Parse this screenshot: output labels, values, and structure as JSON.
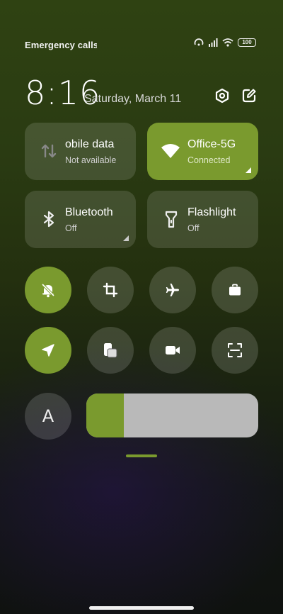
{
  "status_bar": {
    "carrier_text": "Emergency calls o",
    "battery_level": "100"
  },
  "header": {
    "time": "8:16",
    "date": "Saturday, March 11"
  },
  "tiles": [
    {
      "title": "obile data",
      "subtitle": "Not available",
      "icon": "mobile-data-icon",
      "active": false
    },
    {
      "title": "Office-5G",
      "subtitle": "Connected",
      "icon": "wifi-icon",
      "active": true
    },
    {
      "title": "Bluetooth",
      "subtitle": "Off",
      "icon": "bluetooth-icon",
      "active": false
    },
    {
      "title": "Flashlight",
      "subtitle": "Off",
      "icon": "flashlight-icon",
      "active": false
    }
  ],
  "toggles_row1": [
    {
      "icon": "mute-bell-icon",
      "active": true
    },
    {
      "icon": "crop-icon",
      "active": false
    },
    {
      "icon": "airplane-icon",
      "active": false
    },
    {
      "icon": "briefcase-icon",
      "active": false
    }
  ],
  "toggles_row2": [
    {
      "icon": "location-icon",
      "active": true
    },
    {
      "icon": "screen-cast-icon",
      "active": false
    },
    {
      "icon": "video-camera-icon",
      "active": false
    },
    {
      "icon": "scan-icon",
      "active": false
    }
  ],
  "brightness": {
    "auto_label": "A",
    "level": 0.22
  },
  "colors": {
    "accent": "#7a9a2e",
    "tile_inactive": "rgba(255,255,255,0.13)"
  }
}
